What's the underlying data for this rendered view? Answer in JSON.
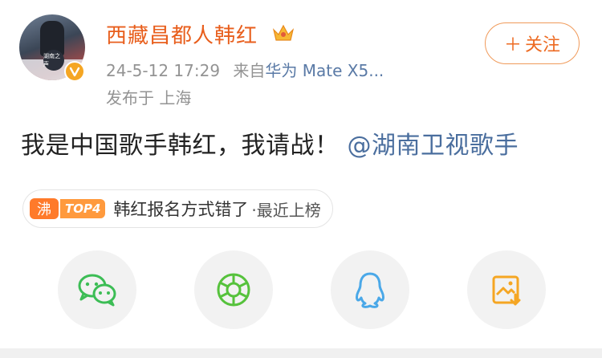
{
  "post": {
    "username": "西藏昌都人韩红",
    "timestamp": "24-5-12 17:29",
    "source_prefix": "来自",
    "device": "华为 Mate X5...",
    "location": "发布于 上海",
    "text": "我是中国歌手韩红，我请战！",
    "mention": "@湖南卫视歌手"
  },
  "follow_button": {
    "plus": "＋",
    "label": "关注"
  },
  "trending": {
    "icon_char": "沸",
    "rank": "TOP4",
    "title": "韩红报名方式错了",
    "suffix": "·最近上榜"
  },
  "avatar_badge": {
    "text": "湖南之声"
  },
  "share_icons": [
    "wechat-icon",
    "moments-icon",
    "qq-icon",
    "save-image-icon"
  ],
  "colors": {
    "username": "#e85e1c",
    "accent": "#ed6a21",
    "mention": "#4a6e9e",
    "wechat": "#3cbd55",
    "moments": "#56c23c",
    "qq": "#4aa8e8",
    "save": "#f5a623"
  }
}
